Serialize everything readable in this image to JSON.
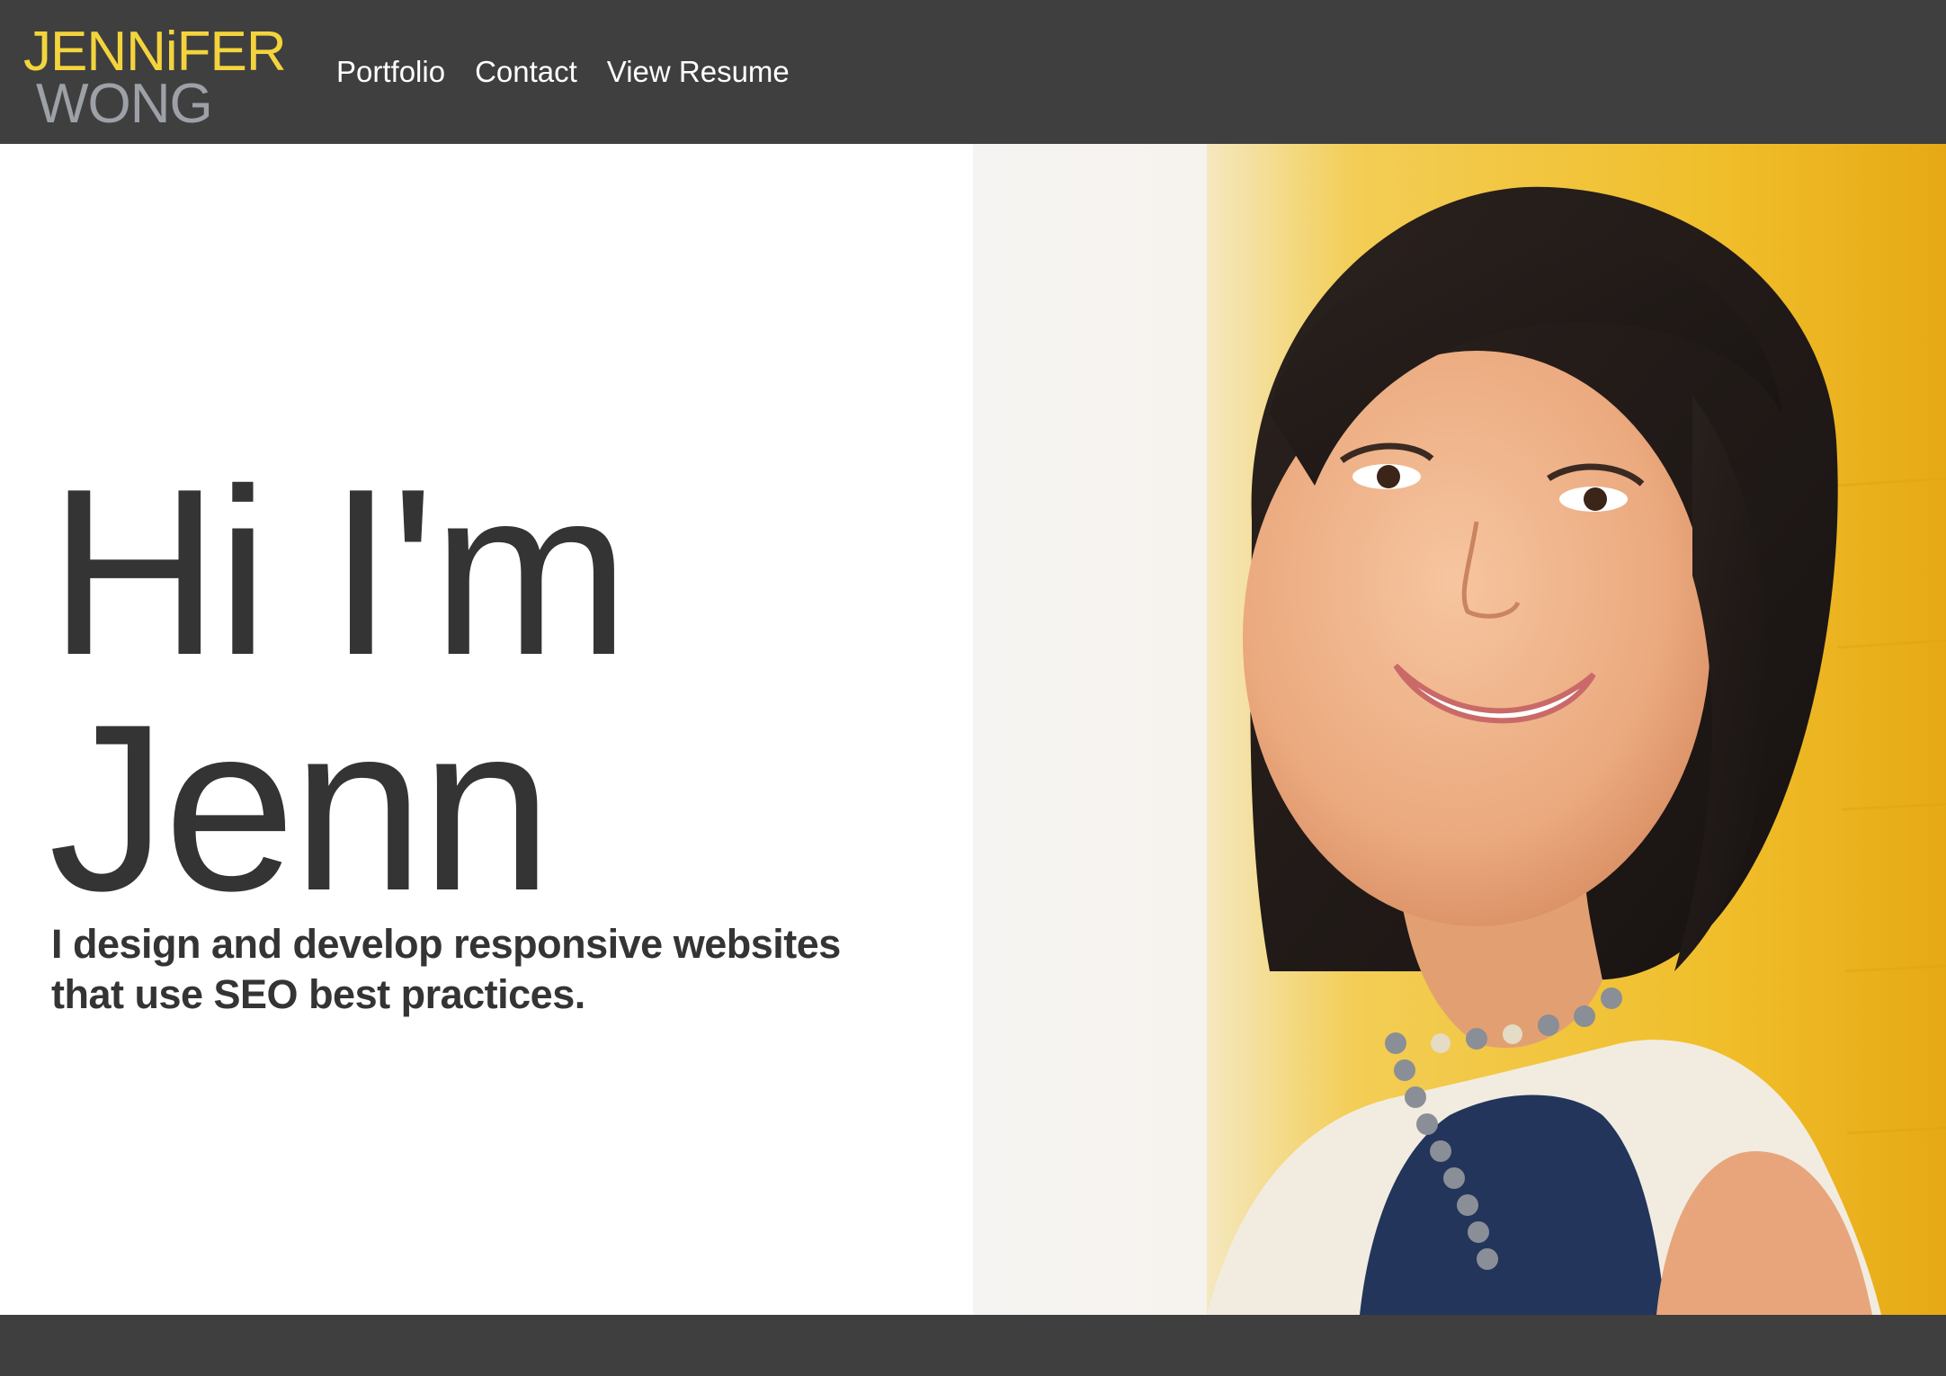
{
  "brand": {
    "first_name": "JENNiFER",
    "last_name": "WONG",
    "first_color": "#f3d43c",
    "last_color": "#9da1a7"
  },
  "nav": {
    "links": [
      {
        "label": "Portfolio"
      },
      {
        "label": "Contact"
      },
      {
        "label": "View Resume"
      }
    ]
  },
  "hero": {
    "headline_line1": "Hi I'm",
    "headline_line2": "Jenn",
    "tagline_line1": "I design and develop responsive websites",
    "tagline_line2": "that use SEO best practices."
  },
  "colors": {
    "nav_bg": "#3f3f3f",
    "text_dark": "#343434",
    "accent_yellow": "#f3c527"
  }
}
